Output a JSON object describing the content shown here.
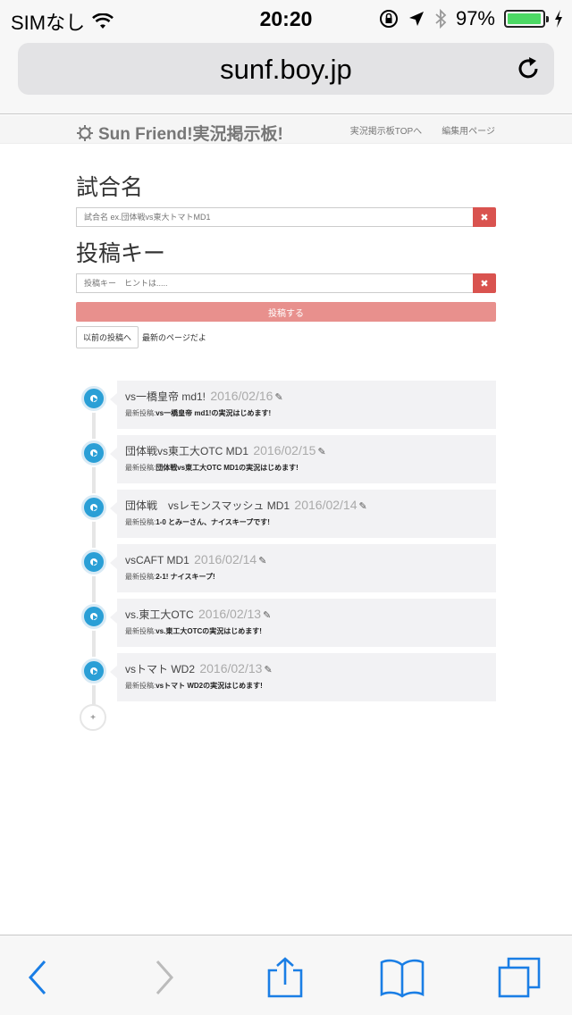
{
  "status_bar": {
    "carrier": "SIMなし",
    "time": "20:20",
    "battery_percent": "97%",
    "battery_level": 0.97,
    "icons": [
      "wifi-icon",
      "rotation-lock-icon",
      "location-icon",
      "bluetooth-icon",
      "charging-icon"
    ]
  },
  "browser": {
    "url": "sunf.boy.jp"
  },
  "site": {
    "logo_text": "Sun Friend!実況掲示板!",
    "nav": [
      "実況掲示板TOPへ",
      "編集用ページ"
    ]
  },
  "form": {
    "match_label": "試合名",
    "match_placeholder": "試合名 ex.団体戦vs東大トマトMD1",
    "key_label": "投稿キー",
    "key_placeholder": "投稿キー　ヒントは.....",
    "clear_symbol": "✖",
    "post_button": "投稿する",
    "prev_button": "以前の投稿へ",
    "latest_text": "最新のページだよ"
  },
  "timeline": {
    "latest_prefix": "最新投稿:",
    "edit_symbol": "✎",
    "add_symbol": "+",
    "items": [
      {
        "title": "vs一橋皇帝 md1!",
        "date": "2016/02/16",
        "latest": "vs一橋皇帝 md1!の実況はじめます!"
      },
      {
        "title": "団体戦vs東工大OTC MD1",
        "date": "2016/02/15",
        "latest": "団体戦vs東工大OTC MD1の実況はじめます!"
      },
      {
        "title": "団体戦　vsレモンスマッシュ MD1",
        "date": "2016/02/14",
        "latest": "1-0 とみーさん、ナイスキープです!"
      },
      {
        "title": "vsCAFT MD1",
        "date": "2016/02/14",
        "latest": "2-1! ナイスキープ!"
      },
      {
        "title": "vs.東工大OTC",
        "date": "2016/02/13",
        "latest": "vs.東工大OTCの実況はじめます!"
      },
      {
        "title": "vsトマト WD2",
        "date": "2016/02/13",
        "latest": "vsトマト WD2の実況はじめます!"
      }
    ]
  },
  "colors": {
    "accent_blue": "#2a9fd6",
    "danger_red": "#d9534f",
    "post_button": "#e8908d",
    "ios_blue": "#1a7ee5"
  }
}
